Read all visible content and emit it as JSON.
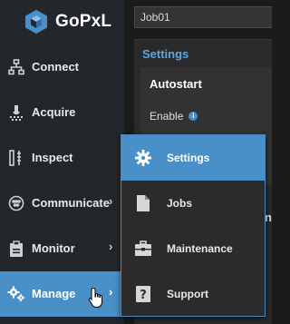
{
  "app": {
    "brand": "GoPxL"
  },
  "sidebar": {
    "items": [
      {
        "label": "Connect",
        "icon": "network-icon",
        "has_submenu": false,
        "active": false
      },
      {
        "label": "Acquire",
        "icon": "acquire-icon",
        "has_submenu": false,
        "active": false
      },
      {
        "label": "Inspect",
        "icon": "inspect-icon",
        "has_submenu": false,
        "active": false
      },
      {
        "label": "Communicate",
        "icon": "communicate-icon",
        "has_submenu": true,
        "active": false
      },
      {
        "label": "Monitor",
        "icon": "clipboard-icon",
        "has_submenu": true,
        "active": false
      },
      {
        "label": "Manage",
        "icon": "gears-icon",
        "has_submenu": true,
        "active": true
      }
    ],
    "chevron": "›"
  },
  "content": {
    "job_name": "Job01",
    "panel_title": "Settings",
    "section_title": "Autostart",
    "enable_label": "Enable",
    "info_glyph": "i",
    "edge_letter": "n"
  },
  "submenu": {
    "items": [
      {
        "label": "Settings",
        "icon": "gear-icon",
        "active": true
      },
      {
        "label": "Jobs",
        "icon": "document-icon",
        "active": false
      },
      {
        "label": "Maintenance",
        "icon": "toolbox-icon",
        "active": false
      },
      {
        "label": "Support",
        "icon": "help-book-icon",
        "active": false
      }
    ]
  },
  "colors": {
    "accent": "#4a90c8",
    "sidebar_bg": "#23272b",
    "content_bg": "#1b1b1b",
    "panel_title": "#5aa7e6"
  }
}
